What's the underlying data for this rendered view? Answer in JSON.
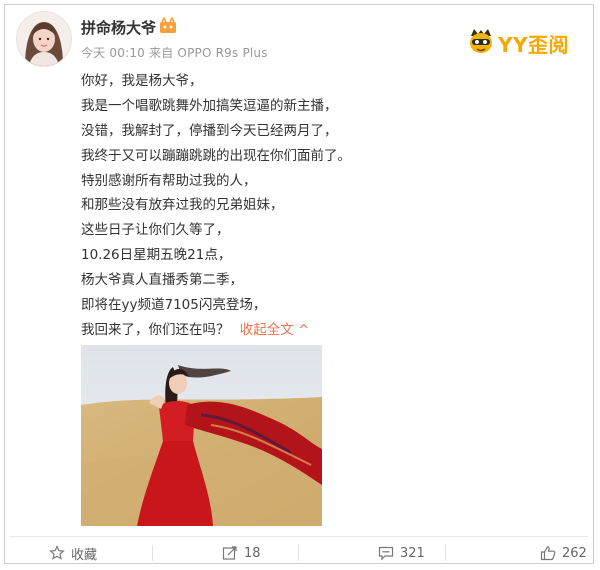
{
  "post": {
    "author": "拼命杨大爷",
    "time": "今天 00:10",
    "source": "来自 OPPO R9s Plus",
    "lines": [
      "你好，我是杨大爷，",
      "我是一个唱歌跳舞外加搞笑逗逼的新主播，",
      "没错，我解封了，停播到今天已经两月了，",
      "我终于又可以蹦蹦跳跳的出现在你们面前了。",
      "特别感谢所有帮助过我的人，",
      "和那些没有放弃过我的兄弟姐妹，",
      "这些日子让你们久等了，",
      "10.26日星期五晚21点，",
      "杨大爷真人直播秀第二季，",
      "即将在yy频道7105闪亮登场，",
      "我回来了，你们还在吗？"
    ],
    "collapse_label": "收起全文 ^"
  },
  "watermark": {
    "brand": "YY歪阅",
    "color": "#f4a800"
  },
  "actions": {
    "favorite": "收藏",
    "forward": "18",
    "comment": "321",
    "like": "262"
  },
  "colors": {
    "link": "#eb7350",
    "meta": "#999999"
  }
}
